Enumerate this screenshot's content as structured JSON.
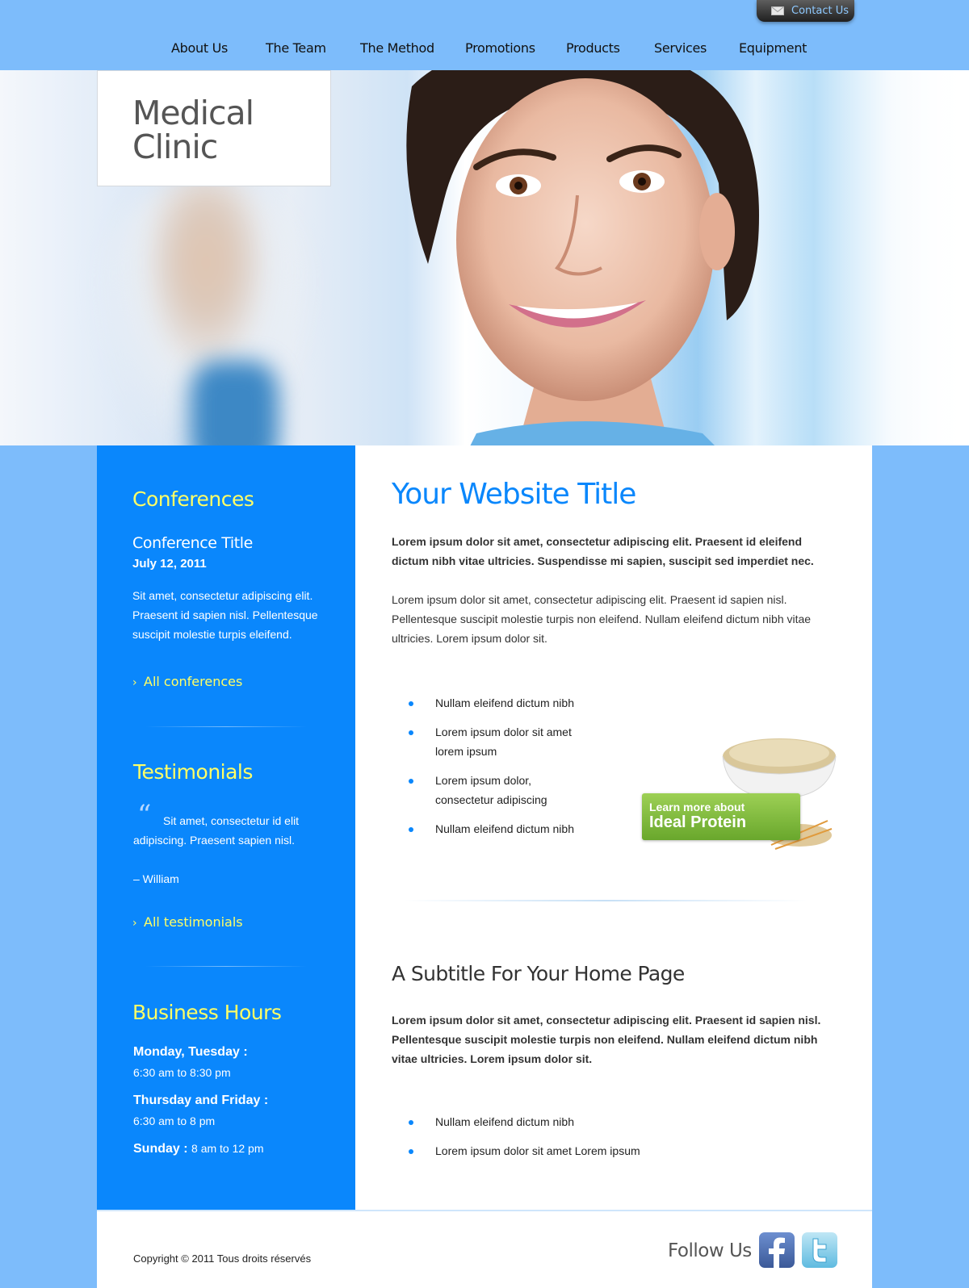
{
  "header": {
    "contact_label": "Contact Us",
    "nav": [
      "About Us",
      "The Team",
      "The Method",
      "Promotions",
      "Products",
      "Services",
      "Equipment"
    ]
  },
  "logo": {
    "line1": "Medical",
    "line2": "Clinic"
  },
  "sidebar": {
    "conferences": {
      "heading": "Conferences",
      "title": "Conference Title",
      "date": "July 12, 2011",
      "text": "Sit amet, consectetur adipiscing elit. Praesent id sapien nisl. Pellentesque suscipit molestie turpis eleifend.",
      "link": "All conferences"
    },
    "testimonials": {
      "heading": "Testimonials",
      "quote_mark": "“",
      "quote": "Sit amet, consectetur id elit adipiscing. Praesent sapien nisl.",
      "author": "– William",
      "link": "All testimonials"
    },
    "hours": {
      "heading": "Business Hours",
      "rows": [
        {
          "days": "Monday, Tuesday :",
          "time": "6:30 am to 8:30 pm"
        },
        {
          "days": "Thursday and Friday :",
          "time": "6:30 am to 8 pm"
        },
        {
          "days": "Sunday :",
          "time": "8 am to 12 pm"
        }
      ]
    },
    "link_chevron": "›"
  },
  "main": {
    "title": "Your Website Title",
    "intro_bold": "Lorem ipsum dolor sit amet, consectetur adipiscing elit. Praesent id eleifend dictum nibh vitae ultricies. Suspendisse mi sapien, suscipit sed imperdiet nec.",
    "intro_text": "Lorem ipsum dolor sit amet, consectetur adipiscing elit. Praesent id sapien nisl. Pellentesque suscipit molestie turpis non eleifend. Nullam eleifend dictum nibh vitae ultricies. Lorem ipsum dolor sit.",
    "list1": [
      "Nullam eleifend dictum nibh",
      "Lorem ipsum dolor sit amet lorem ipsum",
      "Lorem ipsum dolor, consectetur adipiscing",
      "Nullam eleifend dictum nibh"
    ],
    "promo": {
      "line1": "Learn more about",
      "line2": "Ideal Protein"
    },
    "subtitle": "A Subtitle For Your Home Page",
    "sub_bold": "Lorem ipsum dolor sit amet, consectetur adipiscing elit. Praesent id sapien nisl. Pellentesque suscipit molestie turpis non eleifend. Nullam eleifend dictum nibh vitae ultricies. Lorem ipsum dolor sit.",
    "list2": [
      "Nullam eleifend dictum nibh",
      "Lorem ipsum dolor sit amet Lorem ipsum"
    ]
  },
  "footer": {
    "copyright": "Copyright © 2011 Tous droits réservés",
    "follow": "Follow Us"
  },
  "colors": {
    "page_bg": "#7dbcfb",
    "sidebar_bg": "#0a87fc",
    "accent_yellow": "#ffff66",
    "title_blue": "#0a87fc",
    "promo_green": "#7cba3a"
  },
  "icons": [
    "mail-icon",
    "chevron-right-icon",
    "quote-icon",
    "bullet-icon",
    "facebook-icon",
    "twitter-icon"
  ]
}
